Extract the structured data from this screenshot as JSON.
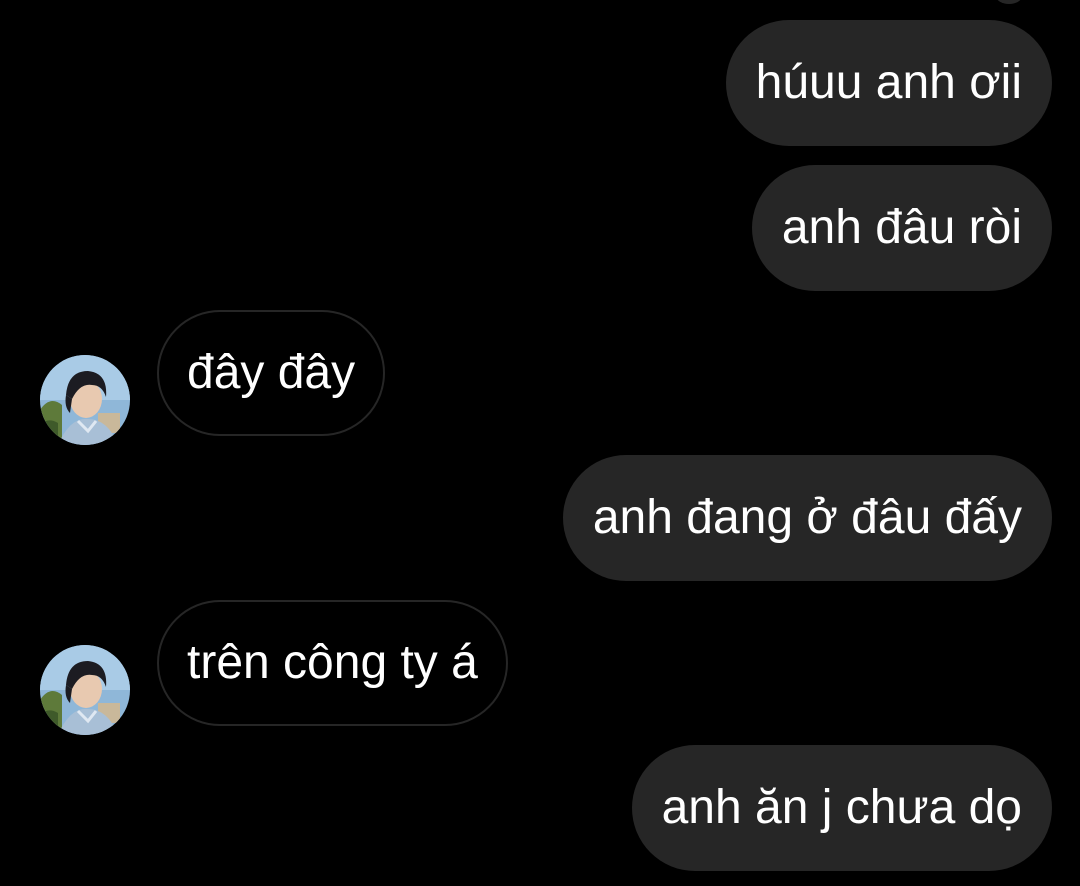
{
  "messages": [
    {
      "id": "m1",
      "direction": "outgoing",
      "text": "húuu anh ơii"
    },
    {
      "id": "m2",
      "direction": "outgoing",
      "text": "anh đâu ròi"
    },
    {
      "id": "m3",
      "direction": "incoming",
      "text": "đây đây",
      "avatar": "contact-avatar"
    },
    {
      "id": "m4",
      "direction": "outgoing",
      "text": "anh đang ở đâu đấy"
    },
    {
      "id": "m5",
      "direction": "incoming",
      "text": "trên công ty á",
      "avatar": "contact-avatar"
    },
    {
      "id": "m6",
      "direction": "outgoing",
      "text": "anh ăn j chưa dọ"
    }
  ],
  "colors": {
    "background": "#000000",
    "outgoing_bubble": "#262626",
    "incoming_border": "#262626",
    "text": "#ffffff"
  }
}
